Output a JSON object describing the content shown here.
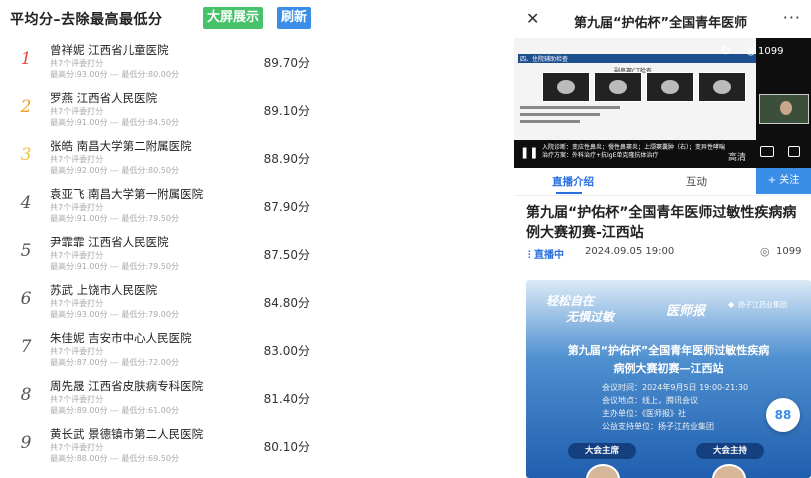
{
  "left_panel": {
    "title": "平均分–去除最高最低分",
    "bigscreen_label": "大屏展示",
    "refresh_label": "刷新",
    "rankings": [
      {
        "rank": "1",
        "name": "曾祥妮 江西省儿童医院",
        "judges": "共7个评委打分",
        "range": "最高分:93.00分 --- 最低分:80.00分",
        "score": "89.70分"
      },
      {
        "rank": "2",
        "name": "罗燕 江西省人民医院",
        "judges": "共7个评委打分",
        "range": "最高分:91.00分 --- 最低分:84.50分",
        "score": "89.10分"
      },
      {
        "rank": "3",
        "name": "张皓 南昌大学第二附属医院",
        "judges": "共7个评委打分",
        "range": "最高分:92.00分 --- 最低分:80.50分",
        "score": "88.90分"
      },
      {
        "rank": "4",
        "name": "袁亚飞 南昌大学第一附属医院",
        "judges": "共7个评委打分",
        "range": "最高分:91.00分 --- 最低分:79.50分",
        "score": "87.90分"
      },
      {
        "rank": "5",
        "name": "尹霏霏 江西省人民医院",
        "judges": "共7个评委打分",
        "range": "最高分:91.00分 --- 最低分:79.50分",
        "score": "87.50分"
      },
      {
        "rank": "6",
        "name": "苏武 上饶市人民医院",
        "judges": "共7个评委打分",
        "range": "最高分:93.00分 --- 最低分:79.00分",
        "score": "84.80分"
      },
      {
        "rank": "7",
        "name": "朱佳妮 吉安市中心人民医院",
        "judges": "共7个评委打分",
        "range": "最高分:87.00分 --- 最低分:72.00分",
        "score": "83.00分"
      },
      {
        "rank": "8",
        "name": "周先晟 江西省皮肤病专科医院",
        "judges": "共7个评委打分",
        "range": "最高分:89.00分 --- 最低分:61.00分",
        "score": "81.40分"
      },
      {
        "rank": "9",
        "name": "黄长武 景德镇市第二人民医院",
        "judges": "共7个评委打分",
        "range": "最高分:88.00分 --- 最低分:69.50分",
        "score": "80.10分"
      }
    ],
    "colors": {
      "rank1": "#e84a4a",
      "rank2": "#f0a020",
      "rank3": "#f3c13a",
      "bigscreen": "#48c26a",
      "refresh": "#3b8ee8"
    }
  },
  "right_panel": {
    "topbar": {
      "close_icon": "close-icon",
      "title": "第九届“护佑杯”全国青年医师",
      "more_icon": "more-icon"
    },
    "video": {
      "view_count": "1099",
      "quality": "高清",
      "slide_heading": "四、住院辅助检查",
      "slide_subheading": "副鼻窦CT检查",
      "caption_line1": "入院诊断：变应性鼻炎；慢性鼻窦炎；上颌窦囊肿（右）；变异性哮喘",
      "caption_line2": "治疗方案：外科治疗+抗IgE单克隆抗体治疗"
    },
    "tabs": [
      {
        "label": "直播介绍",
        "active": true
      },
      {
        "label": "互动",
        "active": false
      }
    ],
    "follow_label": "+ 关注",
    "event": {
      "title": "第九届“护佑杯”全国青年医师过敏性疾病病例大赛初赛-江西站",
      "live_status": "直播中",
      "datetime": "2024.09.05 19:00",
      "views": "1099"
    },
    "poster": {
      "slogan_line1": "轻松自在",
      "slogan_line2": "无惧过敏",
      "brand": "医师报",
      "sponsor": "扬子江药业集团",
      "heading_line1": "第九届“护佑杯”全国青年医师过敏性疾病",
      "heading_line2": "病例大赛初赛—江西站",
      "info": [
        "会议时间：2024年9月5日 19:00-21:30",
        "会议地点：线上，腾讯会议",
        "主办单位：《医师报》社",
        "公益支持单位：扬子江药业集团"
      ],
      "label_chair": "大会主席",
      "label_host": "大会主持",
      "float_button": "88"
    },
    "colors": {
      "accent": "#3b8ee8",
      "tab_active": "#2a6fe0"
    }
  }
}
